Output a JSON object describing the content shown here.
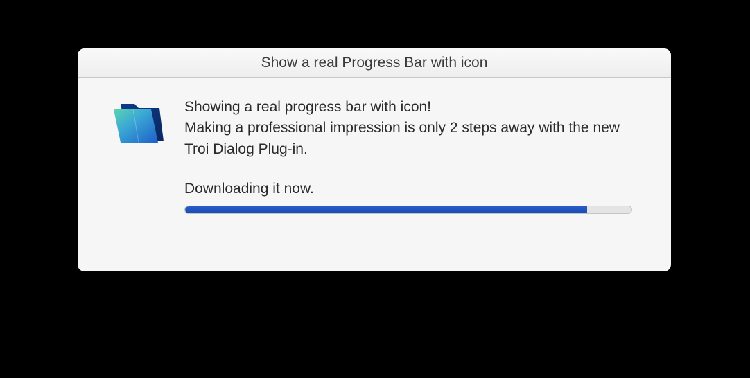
{
  "dialog": {
    "title": "Show a real Progress Bar with icon",
    "body_line1": "Showing a real progress bar with icon!",
    "body_line2": "Making a professional impression is only 2 steps away with the new Troi Dialog Plug-in.",
    "status": "Downloading it now.",
    "progress_percent": 90,
    "icon": "folder-icon",
    "colors": {
      "progress_fill": "#1a4db8",
      "dialog_bg": "#f6f6f6",
      "title_bg_top": "#f9f9f9",
      "title_bg_bottom": "#eeeeee"
    }
  }
}
